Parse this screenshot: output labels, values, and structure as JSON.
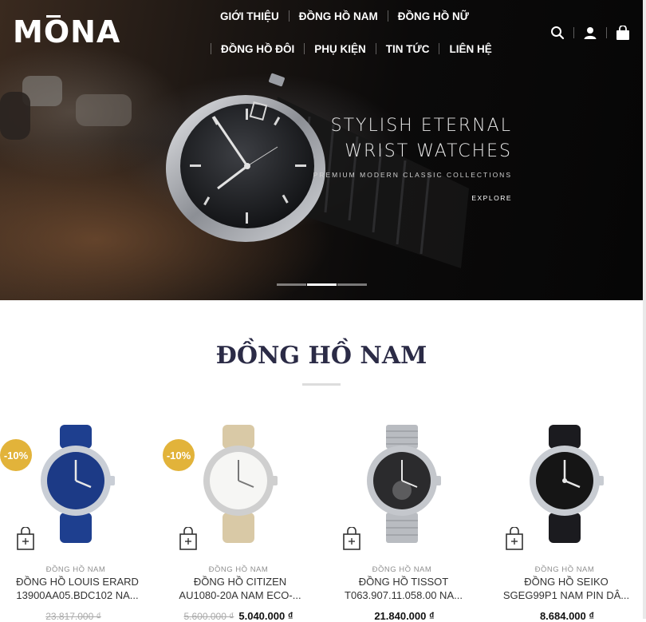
{
  "brand": {
    "logo": "MONA"
  },
  "nav": {
    "row1": [
      "GIỚI THIỆU",
      "ĐỒNG HỒ NAM",
      "ĐỒNG HỒ NỮ"
    ],
    "row2": [
      "ĐỒNG HỒ ĐÔI",
      "PHỤ KIỆN",
      "TIN TỨC",
      "LIÊN HỆ"
    ]
  },
  "header_icons": [
    "search-icon",
    "user-icon",
    "cart-icon"
  ],
  "hero": {
    "title_line1": "STYLISH ETERNAL",
    "title_line2": "WRIST WATCHES",
    "subtitle": "PREMIUM MODERN CLASSIC COLLECTIONS",
    "button": "EXPLORE",
    "slides": 3,
    "active_slide": 2
  },
  "section": {
    "title": "ĐỒNG HỒ NAM"
  },
  "colors": {
    "accent_badge": "#e2b33a",
    "title": "#2b2b46"
  },
  "products": [
    {
      "badge": "-10%",
      "category": "ĐỒNG HỒ NAM",
      "name_line1": "ĐỒNG HỒ LOUIS ERARD",
      "name_line2": "13900AA05.BDC102 NA...",
      "old_price": "23.817.000 ₫",
      "price": "",
      "dial": "#1c3a86",
      "strap": "#1e3f8f",
      "case": "#c9ced6"
    },
    {
      "badge": "-10%",
      "category": "ĐỒNG HỒ NAM",
      "name_line1": "ĐỒNG HỒ CITIZEN",
      "name_line2": "AU1080-20A NAM ECO-...",
      "old_price": "5.600.000 ₫",
      "price": "5.040.000 ₫",
      "dial": "#f6f6f4",
      "strap": "#d9c9a6",
      "case": "#cfcfcf"
    },
    {
      "badge": "",
      "category": "ĐỒNG HỒ NAM",
      "name_line1": "ĐỒNG HỒ TISSOT",
      "name_line2": "T063.907.11.058.00 NA...",
      "old_price": "",
      "price": "21.840.000 ₫",
      "dial": "#2b2b2d",
      "strap": "#b9bcc1",
      "case": "#c4c7cc"
    },
    {
      "badge": "",
      "category": "ĐỒNG HỒ NAM",
      "name_line1": "ĐỒNG HỒ SEIKO",
      "name_line2": "SGEG99P1 NAM PIN DÂ...",
      "old_price": "",
      "price": "8.684.000 ₫",
      "dial": "#151515",
      "strap": "#1b1b1f",
      "case": "#c8ccd2"
    }
  ]
}
